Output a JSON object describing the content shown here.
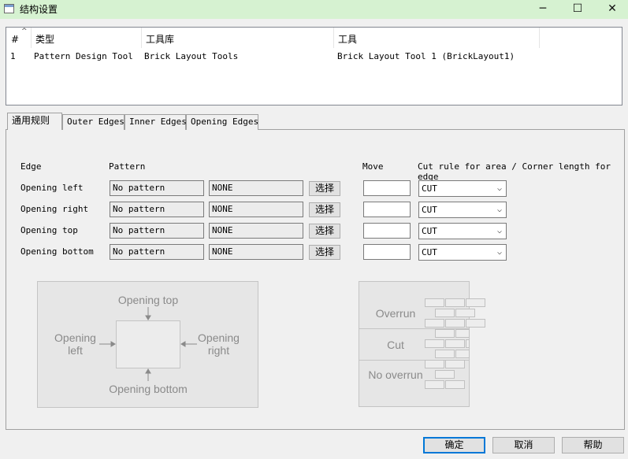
{
  "window": {
    "title": "结构设置",
    "minimize_glyph": "─",
    "maximize_glyph": "☐",
    "close_glyph": "✕"
  },
  "tool_list": {
    "columns": [
      "#",
      "类型",
      "工具库",
      "工具"
    ],
    "rows": [
      [
        "1",
        "Pattern Design Tool",
        "Brick Layout Tools",
        "Brick Layout Tool 1 (BrickLayout1)"
      ]
    ]
  },
  "tabs": [
    {
      "label": "通用规则",
      "active": true
    },
    {
      "label": "Outer Edges",
      "active": false
    },
    {
      "label": "Inner Edges",
      "active": false
    },
    {
      "label": "Opening Edges",
      "active": false
    }
  ],
  "grid": {
    "headers": {
      "edge": "Edge",
      "pattern": "Pattern",
      "move": "Move",
      "cut_rule": "Cut rule for area / Corner length for edge"
    },
    "rows": [
      {
        "edge": "Opening left",
        "pattern": "No pattern",
        "pattern2": "NONE",
        "select": "选择",
        "move": "",
        "cut": "CUT"
      },
      {
        "edge": "Opening right",
        "pattern": "No pattern",
        "pattern2": "NONE",
        "select": "选择",
        "move": "",
        "cut": "CUT"
      },
      {
        "edge": "Opening top",
        "pattern": "No pattern",
        "pattern2": "NONE",
        "select": "选择",
        "move": "",
        "cut": "CUT"
      },
      {
        "edge": "Opening bottom",
        "pattern": "No pattern",
        "pattern2": "NONE",
        "select": "选择",
        "move": "",
        "cut": "CUT"
      }
    ]
  },
  "opening_diagram": {
    "top": "Opening top",
    "left": "Opening\nleft",
    "right": "Opening\nright",
    "bottom": "Opening bottom"
  },
  "overrun_diagram": {
    "overrun": "Overrun",
    "cut": "Cut",
    "no_overrun": "No overrun"
  },
  "buttons": {
    "ok": "确定",
    "cancel": "取消",
    "help": "帮助"
  }
}
